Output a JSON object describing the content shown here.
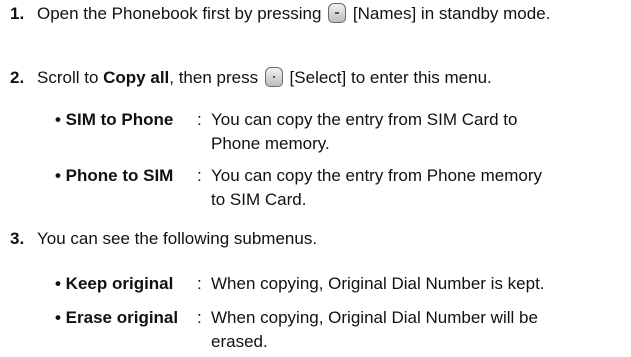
{
  "steps": [
    {
      "number": "1.",
      "text_before": "Open the Phonebook first by pressing ",
      "key_icon": "left-soft-key-icon",
      "key_label": " [Names] in standby mode."
    },
    {
      "number": "2.",
      "text_before": "Scroll to ",
      "bold": "Copy all",
      "text_after": ", then press ",
      "key_icon": "center-select-key-icon",
      "key_label": " [Select] to enter this menu."
    },
    {
      "number": "3.",
      "text": "You can see the following submenus."
    }
  ],
  "copy_options": [
    {
      "term": "• SIM to Phone",
      "colon": ":",
      "desc_line1": "You can copy the entry from SIM Card to",
      "desc_line2": "Phone memory."
    },
    {
      "term": "• Phone to SIM",
      "colon": ":",
      "desc_line1": "You can copy the entry from Phone memory",
      "desc_line2": "to SIM Card."
    }
  ],
  "submenus": [
    {
      "term": "• Keep original",
      "colon": ":",
      "desc_line1": "When copying, Original Dial Number is kept.",
      "desc_line2": ""
    },
    {
      "term": "• Erase original",
      "colon": ":",
      "desc_line1": "When copying, Original Dial Number will be",
      "desc_line2": "erased."
    }
  ]
}
